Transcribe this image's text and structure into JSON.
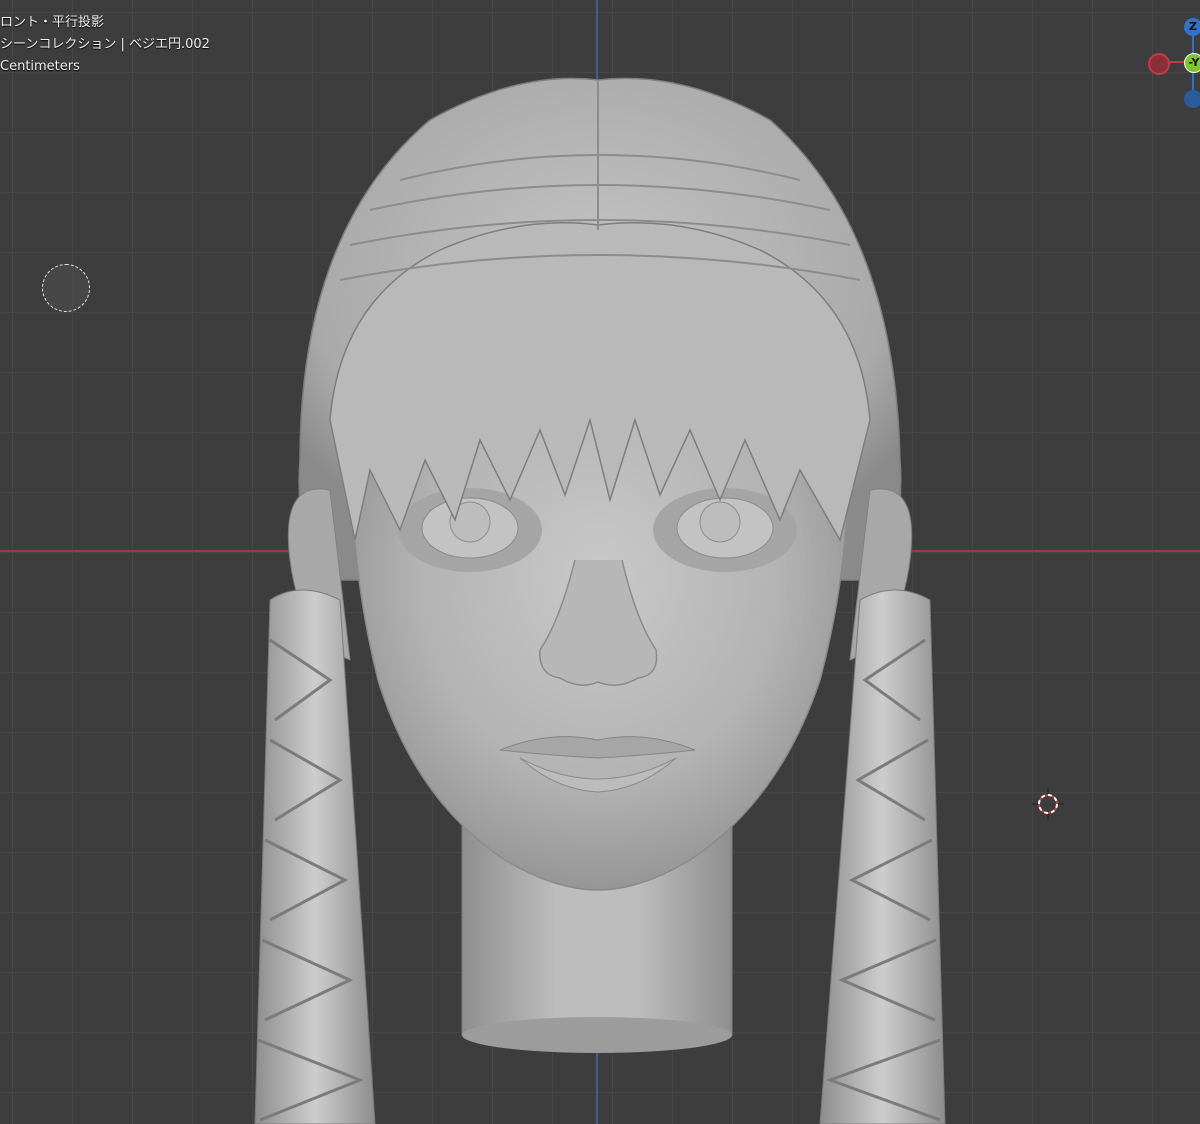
{
  "viewport_overlay": {
    "view_name": "ロント・平行投影",
    "collection_info": "シーンコレクション | ベジエ円.002",
    "units": "Centimeters"
  },
  "gizmo": {
    "z_label": "Z",
    "y_label": "-Y",
    "colors": {
      "z_axis": "#2f72c9",
      "y_axis": "#7cc72c",
      "x_axis": "#c43b48"
    }
  },
  "colors": {
    "background": "#3d3d3d",
    "grid": "#484848",
    "x_axis_line": "#8f3e48",
    "z_axis_line": "#3f5f93",
    "clay": "#b4b4b4"
  },
  "model": {
    "icon": "sculpted-head-with-braids"
  }
}
